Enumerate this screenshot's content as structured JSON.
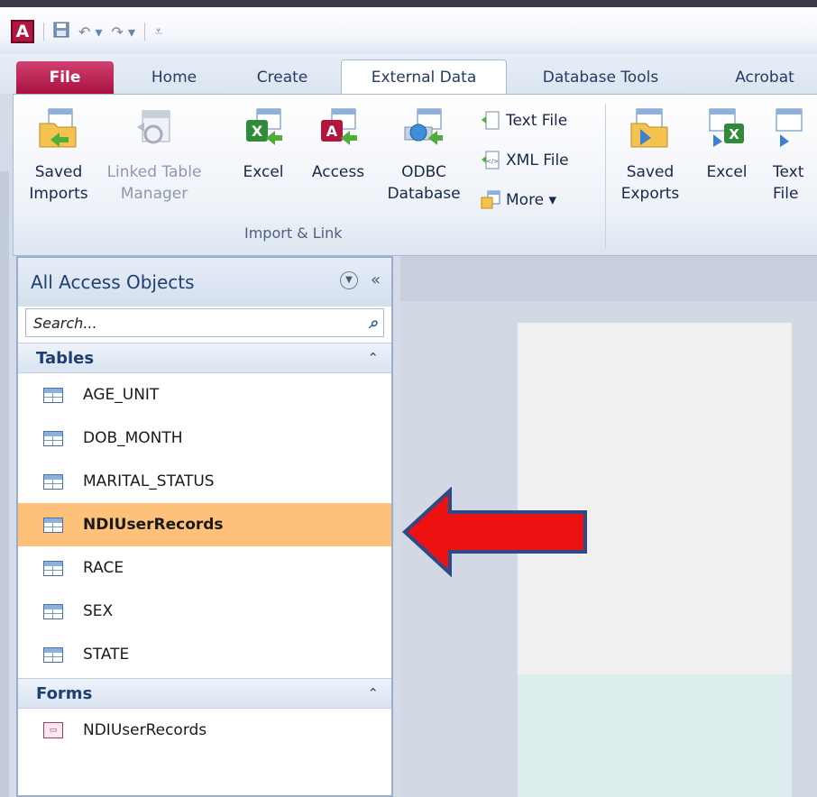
{
  "quick_access": {
    "app_letter": "A",
    "icons": [
      "save-icon",
      "undo-icon",
      "redo-icon",
      "customize-icon"
    ]
  },
  "tabs": [
    {
      "label": "File"
    },
    {
      "label": "Home"
    },
    {
      "label": "Create"
    },
    {
      "label": "External Data",
      "active": true
    },
    {
      "label": "Database Tools"
    },
    {
      "label": "Acrobat"
    }
  ],
  "ribbon": {
    "import_group": {
      "label": "Import & Link",
      "saved_imports": "Saved\nImports",
      "linked_table_manager": "Linked Table\nManager",
      "excel": "Excel",
      "access": "Access",
      "odbc": "ODBC\nDatabase",
      "text_file": "Text File",
      "xml_file": "XML File",
      "more": "More ▾"
    },
    "export_group": {
      "saved_exports": "Saved\nExports",
      "excel": "Excel",
      "text_file": "Text\nFile"
    }
  },
  "nav": {
    "header": "All Access Objects",
    "search_placeholder": "Search...",
    "sections": {
      "tables": "Tables",
      "forms": "Forms"
    },
    "tables": [
      "AGE_UNIT",
      "DOB_MONTH",
      "MARITAL_STATUS",
      "NDIUserRecords",
      "RACE",
      "SEX",
      "STATE"
    ],
    "selected_table": "NDIUserRecords",
    "forms": [
      "NDIUserRecords"
    ]
  },
  "colors": {
    "selected_row": "#fdc17a",
    "arrow_fill": "#ee1111",
    "arrow_stroke": "#2e4a86",
    "file_tab": "#b8174a"
  }
}
